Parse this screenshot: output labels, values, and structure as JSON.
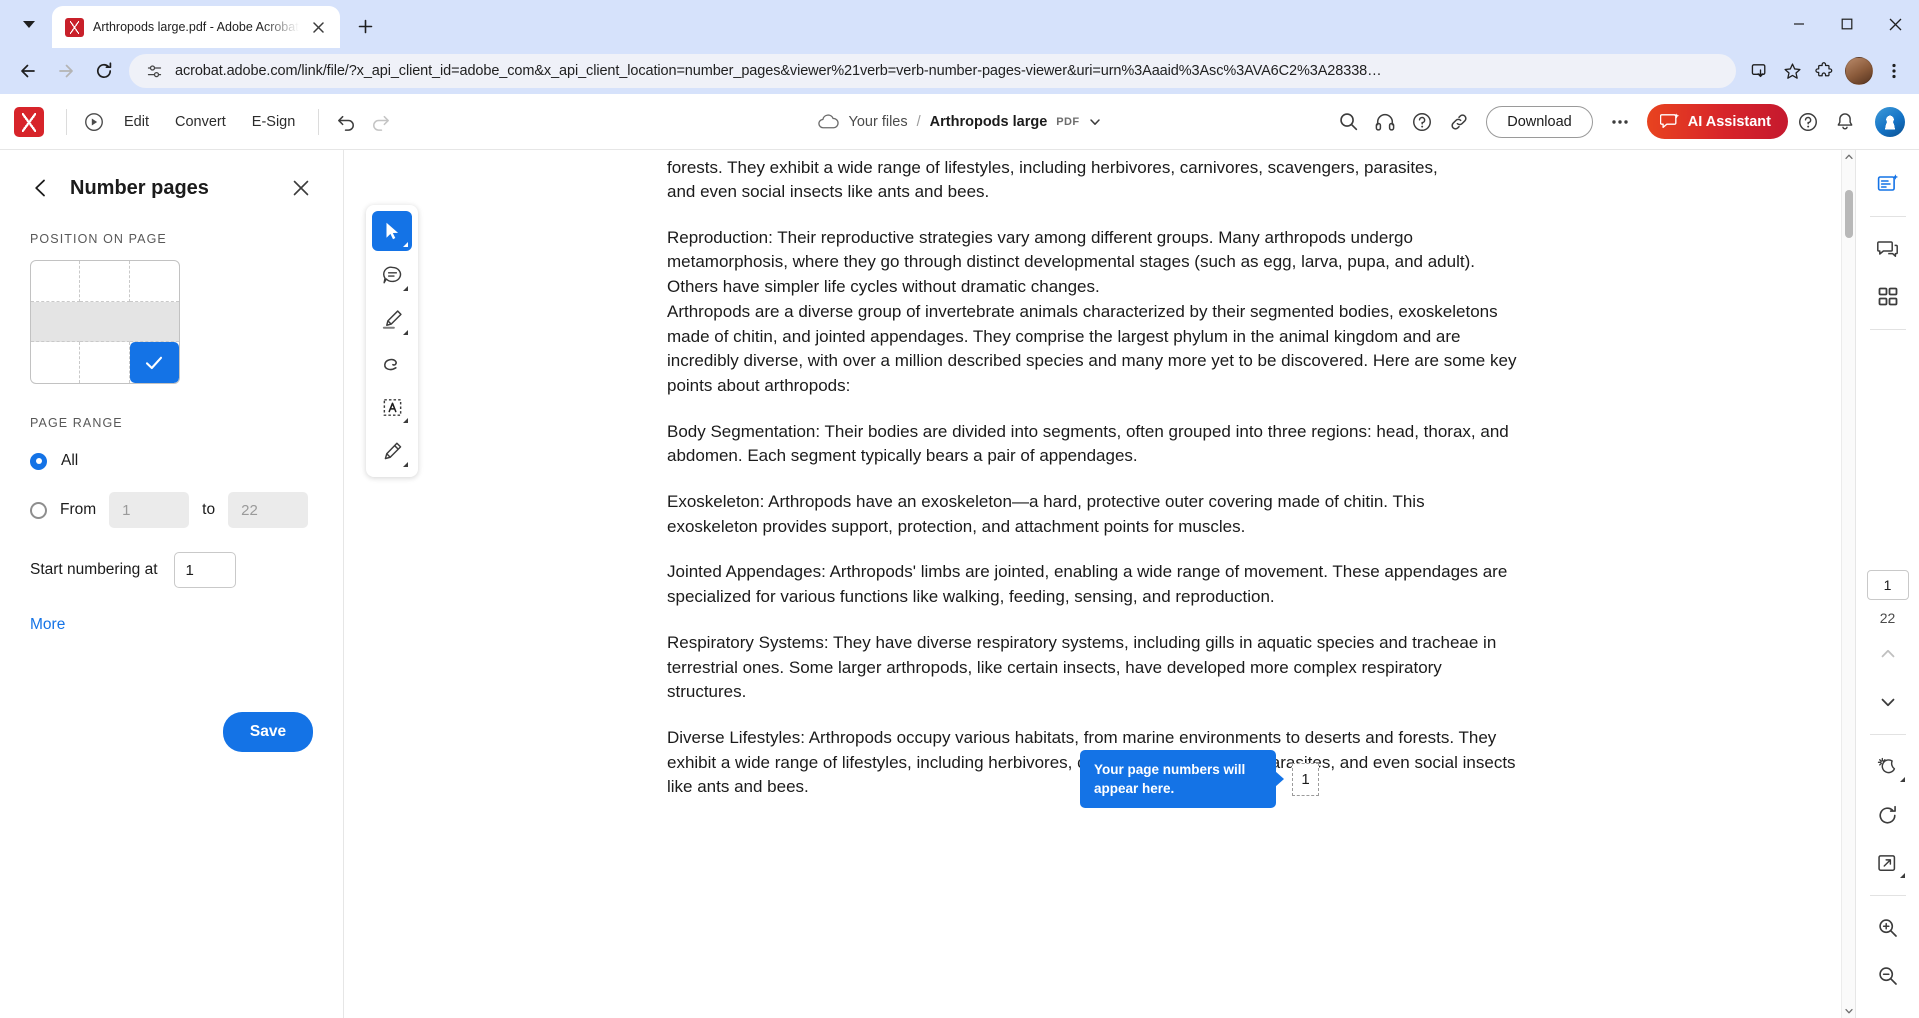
{
  "browser": {
    "tab": {
      "title": "Arthropods large.pdf - Adobe Acrobat",
      "favicon": "pdf-file-icon",
      "close_icon": "close-icon"
    },
    "tab_list_icon": "chevron-down-icon",
    "new_tab_icon": "plus-icon",
    "window_controls": {
      "minimize": "minimize-icon",
      "maximize": "maximize-icon",
      "close": "close-icon"
    },
    "nav": {
      "back_icon": "back-arrow-icon",
      "forward_icon": "forward-arrow-icon",
      "reload_icon": "reload-icon"
    },
    "omnibox": {
      "site_info_icon": "tune-settings-icon",
      "url": "acrobat.adobe.com/link/file/?x_api_client_id=adobe_com&x_api_client_location=number_pages&viewer%21verb=verb-number-pages-viewer&uri=urn%3Aaaid%3Asc%3AVA6C2%3A28338…",
      "install_icon": "install-app-icon",
      "bookmark_icon": "star-icon",
      "extensions_icon": "extensions-puzzle-icon",
      "profile_icon": "profile-avatar",
      "menu_icon": "three-dot-menu-icon"
    }
  },
  "acrobat_header": {
    "logo": "adobe-acrobat-logo",
    "home_icon": "acrobat-home-icon",
    "menus": [
      "Edit",
      "Convert",
      "E-Sign"
    ],
    "undo_icon": "undo-icon",
    "redo_icon": "redo-icon",
    "cloud_icon": "cloud-icon",
    "breadcrumb": {
      "parent": "Your files",
      "separator": "/",
      "document": "Arthropods large",
      "badge": "PDF",
      "dropdown_icon": "chevron-down-icon"
    },
    "right_icons": [
      "search-icon",
      "headphones-read-aloud-icon",
      "comment-feedback-icon",
      "share-link-icon"
    ],
    "download_label": "Download",
    "more_icon": "three-dot-menu-icon",
    "ai_assistant_label": "AI Assistant",
    "ai_assistant_icon": "ai-sparkle-icon",
    "help_icon": "help-question-icon",
    "bell_icon": "notification-bell-icon",
    "avatar": "user-avatar"
  },
  "left_panel": {
    "back_icon": "back-chevron-icon",
    "title": "Number pages",
    "close_icon": "close-icon",
    "position_section_label": "Position on page",
    "position_grid": {
      "rows": 3,
      "cols": 3,
      "selected_index": 8,
      "selected_label": "bottom-right",
      "check_icon": "checkmark-icon",
      "selected_color": "#1473e6"
    },
    "page_range_label": "Page range",
    "all_option": {
      "label": "All",
      "selected": true
    },
    "from_option": {
      "label": "From",
      "selected": false,
      "from_value": "",
      "from_placeholder": "1",
      "to_word": "to",
      "to_value": "",
      "to_placeholder": "22"
    },
    "start_numbering": {
      "label": "Start numbering at",
      "value": "1"
    },
    "more_label": "More",
    "save_label": "Save"
  },
  "tool_palette": [
    {
      "name": "select-tool",
      "icon": "cursor-arrow-icon",
      "active": true,
      "has_caret": true
    },
    {
      "name": "comment-tool",
      "icon": "comment-bubble-icon",
      "active": false,
      "has_caret": true
    },
    {
      "name": "highlight-tool",
      "icon": "highlighter-pen-icon",
      "active": false,
      "has_caret": true
    },
    {
      "name": "draw-tool",
      "icon": "freehand-loop-icon",
      "active": false,
      "has_caret": false
    },
    {
      "name": "add-text-tool",
      "icon": "text-box-a-icon",
      "active": false,
      "has_caret": true
    },
    {
      "name": "sign-tool",
      "icon": "signature-pen-icon",
      "active": false,
      "has_caret": true
    }
  ],
  "document": {
    "clipped_line": "forests. They exhibit a wide range of lifestyles, including herbivores, carnivores, scavengers, parasites,",
    "paragraphs": [
      "and even social insects like ants and bees.",
      "Reproduction: Their reproductive strategies vary among different groups. Many arthropods undergo metamorphosis, where they go through distinct developmental stages (such as egg, larva, pupa, and adult). Others have simpler life cycles without dramatic changes.",
      "Arthropods are a diverse group of invertebrate animals characterized by their segmented bodies, exoskeletons made of chitin, and jointed appendages. They comprise the largest phylum in the animal kingdom and are incredibly diverse, with over a million described species and many more yet to be discovered. Here are some key points about arthropods:",
      "Body Segmentation: Their bodies are divided into segments, often grouped into three regions: head, thorax, and abdomen. Each segment typically bears a pair of appendages.",
      "Exoskeleton: Arthropods have an exoskeleton—a hard, protective outer covering made of chitin. This exoskeleton provides support, protection, and attachment points for muscles.",
      "Jointed Appendages: Arthropods' limbs are jointed, enabling a wide range of movement. These appendages are specialized for various functions like walking, feeding, sensing, and reproduction.",
      "Respiratory Systems: They have diverse respiratory systems, including gills in aquatic species and tracheae in terrestrial ones. Some larger arthropods, like certain insects, have developed more complex respiratory structures.",
      "Diverse Lifestyles: Arthropods occupy various habitats, from marine environments to deserts and forests. They exhibit a wide range of lifestyles, including herbivores, carnivores, scavengers, parasites, and even social insects like ants and bees."
    ]
  },
  "callout": {
    "text": "Your page numbers will appear here.",
    "page_number_preview": "1",
    "background": "#1473e6"
  },
  "right_rail": {
    "top_items": [
      {
        "name": "edit-pdf-icon",
        "label": "edit-pdf"
      },
      {
        "name": "comments-icon",
        "label": "comments"
      },
      {
        "name": "page-thumbnails-icon",
        "label": "page-thumbnails"
      }
    ],
    "current_page": "1",
    "total_pages": "22",
    "prev_page_icon": "chevron-up-icon",
    "next_page_icon": "chevron-down-icon",
    "bottom_items": [
      {
        "name": "display-theme-icon",
        "label": "display-mode",
        "has_caret": true
      },
      {
        "name": "rotate-icon",
        "label": "rotate-page",
        "has_caret": false
      },
      {
        "name": "fit-page-icon",
        "label": "fit-page",
        "has_caret": true
      },
      {
        "name": "zoom-in-icon",
        "label": "zoom-in",
        "has_caret": false
      },
      {
        "name": "zoom-out-icon",
        "label": "zoom-out",
        "has_caret": false
      }
    ]
  }
}
